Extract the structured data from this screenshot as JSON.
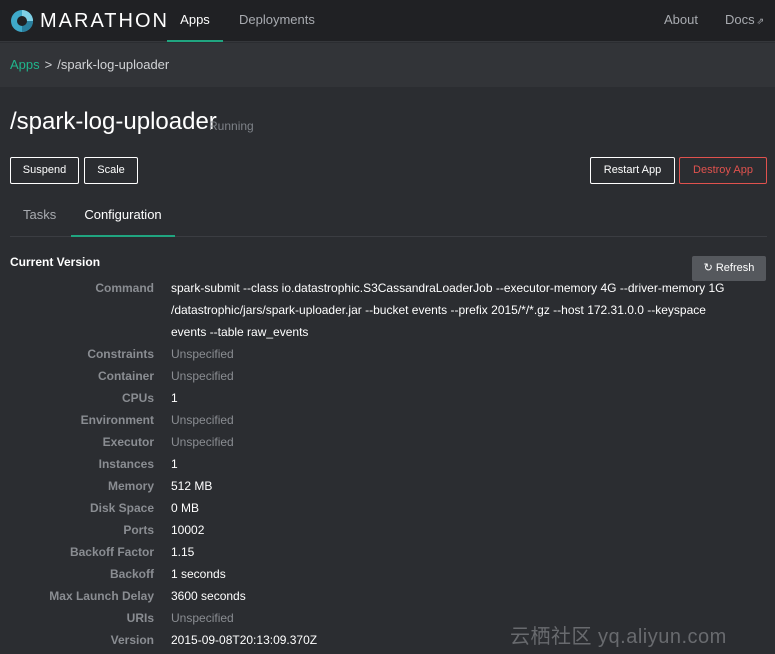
{
  "nav": {
    "brand": "MARATHON",
    "links": [
      {
        "label": "Apps",
        "active": true
      },
      {
        "label": "Deployments",
        "active": false
      }
    ],
    "right_links": [
      {
        "label": "About"
      },
      {
        "label": "Docs"
      }
    ],
    "docs_icon": "external-link-icon"
  },
  "breadcrumb": {
    "root": "Apps",
    "separator": ">",
    "current": "/spark-log-uploader"
  },
  "app": {
    "title": "/spark-log-uploader",
    "status": "Running"
  },
  "actions": {
    "suspend": "Suspend",
    "scale": "Scale",
    "restart": "Restart App",
    "destroy": "Destroy App"
  },
  "tabs": [
    {
      "label": "Tasks",
      "active": false
    },
    {
      "label": "Configuration",
      "active": true
    }
  ],
  "config": {
    "section_title": "Current Version",
    "refresh_label": "Refresh",
    "refresh_icon": "refresh-icon",
    "rows": [
      {
        "label": "Command",
        "value": "spark-submit --class io.datastrophic.S3CassandraLoaderJob --executor-memory 4G --driver-memory 1G /datastrophic/jars/spark-uploader.jar --bucket events --prefix 2015/*/*.gz --host 172.31.0.0 --keyspace events --table raw_events",
        "muted": false
      },
      {
        "label": "Constraints",
        "value": "Unspecified",
        "muted": true
      },
      {
        "label": "Container",
        "value": "Unspecified",
        "muted": true
      },
      {
        "label": "CPUs",
        "value": "1",
        "muted": false
      },
      {
        "label": "Environment",
        "value": "Unspecified",
        "muted": true
      },
      {
        "label": "Executor",
        "value": "Unspecified",
        "muted": true
      },
      {
        "label": "Instances",
        "value": "1",
        "muted": false
      },
      {
        "label": "Memory",
        "value": "512 MB",
        "muted": false
      },
      {
        "label": "Disk Space",
        "value": "0 MB",
        "muted": false
      },
      {
        "label": "Ports",
        "value": "10002",
        "muted": false
      },
      {
        "label": "Backoff Factor",
        "value": "1.15",
        "muted": false
      },
      {
        "label": "Backoff",
        "value": "1 seconds",
        "muted": false
      },
      {
        "label": "Max Launch Delay",
        "value": "3600 seconds",
        "muted": false
      },
      {
        "label": "URIs",
        "value": "Unspecified",
        "muted": true
      },
      {
        "label": "Version",
        "value": "2015-09-08T20:13:09.370Z",
        "muted": false
      }
    ]
  },
  "watermark": "云栖社区 yq.aliyun.com",
  "colors": {
    "accent": "#20a580",
    "danger": "#e0524e",
    "navbar_bg": "#202124",
    "page_bg": "#2b2d31"
  }
}
